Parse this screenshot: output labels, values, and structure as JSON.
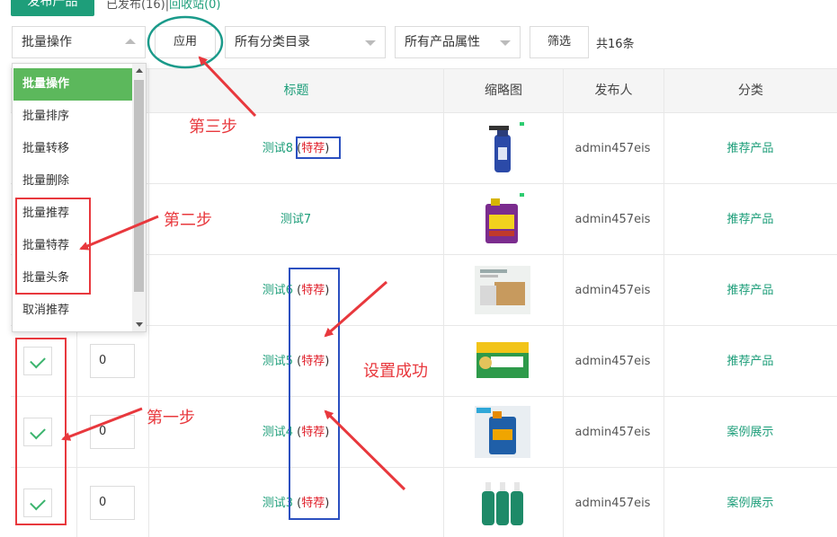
{
  "top": {
    "publish_label": "发布产品",
    "tab_a": "已发布(16)",
    "tab_sep": "|",
    "tab_b": "回收站(0)"
  },
  "toolbar": {
    "batch_select_value": "批量操作",
    "apply_label": "应用",
    "category_select_value": "所有分类目录",
    "attribute_select_value": "所有产品属性",
    "filter_label": "筛选",
    "total_text": "共16条"
  },
  "dropdown": {
    "options": [
      "批量操作",
      "批量排序",
      "批量转移",
      "批量删除",
      "批量推荐",
      "批量特荐",
      "批量头条",
      "取消推荐"
    ],
    "selected_index": 0
  },
  "table": {
    "headers": {
      "title": "标题",
      "thumbnail": "缩略图",
      "author": "发布人",
      "category": "分类"
    },
    "rows": [
      {
        "checked": false,
        "sort": "",
        "title": "测试8",
        "tag": "特荐",
        "author": "admin457eis",
        "category": "推荐产品",
        "thumb": "spray-bottle"
      },
      {
        "checked": false,
        "sort": "",
        "title": "测试7",
        "tag": "",
        "author": "admin457eis",
        "category": "推荐产品",
        "thumb": "oil-can"
      },
      {
        "checked": false,
        "sort": "",
        "title": "测试6",
        "tag": "特荐",
        "author": "admin457eis",
        "category": "推荐产品",
        "thumb": "carton-box"
      },
      {
        "checked": true,
        "sort": "0",
        "title": "测试5",
        "tag": "特荐",
        "author": "admin457eis",
        "category": "推荐产品",
        "thumb": "charcoal-box"
      },
      {
        "checked": true,
        "sort": "0",
        "title": "测试4",
        "tag": "特荐",
        "author": "admin457eis",
        "category": "案例展示",
        "thumb": "engine-oil"
      },
      {
        "checked": true,
        "sort": "0",
        "title": "测试3",
        "tag": "特荐",
        "author": "admin457eis",
        "category": "案例展示",
        "thumb": "bottles"
      }
    ]
  },
  "annotations": {
    "step1": "第一步",
    "step2": "第二步",
    "step3": "第三步",
    "success": "设置成功",
    "color": "#e8383d",
    "box_blue": "#2b50c0",
    "circle_teal": "#1a9a8a"
  },
  "colors": {
    "brand": "#1e9e7a",
    "selected_option": "#5cb85c",
    "tag_red": "#e0202b"
  }
}
